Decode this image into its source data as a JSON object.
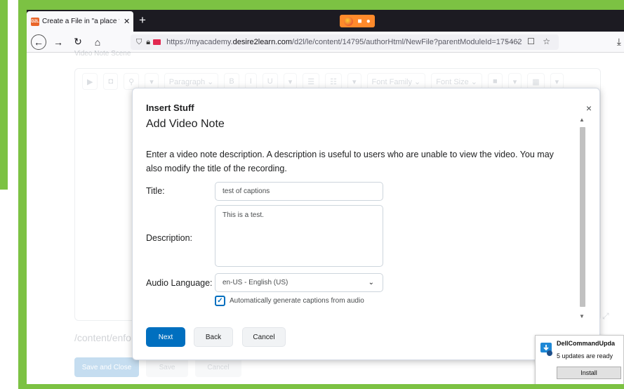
{
  "browser": {
    "tab_title": "Create a File in \"a place for my",
    "tab_favicon": "D2L",
    "tab_close": "✕",
    "new_tab": "+",
    "url_prefix": "https://myacademy.",
    "url_domain": "desire2learn.com",
    "url_suffix": "/d2l/le/content/14795/authorHtml/NewFile?parentModuleId=175462",
    "url_actions": "··· ☐ ☆",
    "colors": {
      "accent_green": "#7cc243",
      "recording": "#ff8a2b"
    }
  },
  "editor": {
    "hint": "Video Note Scene",
    "toolbar": [
      "▶",
      "◘",
      "⚲",
      "▾",
      "Paragraph ⌄",
      "B",
      "I",
      "U",
      "▾",
      "☰",
      "☷",
      "▾",
      "Font Family ⌄",
      "Font Size ⌄",
      "■",
      "▾",
      "▦",
      "▾"
    ],
    "path": "/content/enfor",
    "save_close_label": "Save and Close",
    "save_label": "Save",
    "cancel_label": "Cancel"
  },
  "dialog": {
    "kicker": "Insert Stuff",
    "title": "Add Video Note",
    "description": "Enter a video note description. A description is useful to users who are unable to view the video. You may also modify the title of the recording.",
    "title_label": "Title:",
    "title_value": "test of captions",
    "description_label": "Description:",
    "description_value": "This is a test.",
    "language_label": "Audio Language:",
    "language_value": "en-US - English (US)",
    "captions_checked": true,
    "captions_label": "Automatically generate captions from audio",
    "next_label": "Next",
    "back_label": "Back",
    "cancel_label": "Cancel",
    "close": "×",
    "primary_color": "#006fbf"
  },
  "toast": {
    "title": "DellCommandUpda",
    "text": "5 updates are ready",
    "button": "Install"
  }
}
